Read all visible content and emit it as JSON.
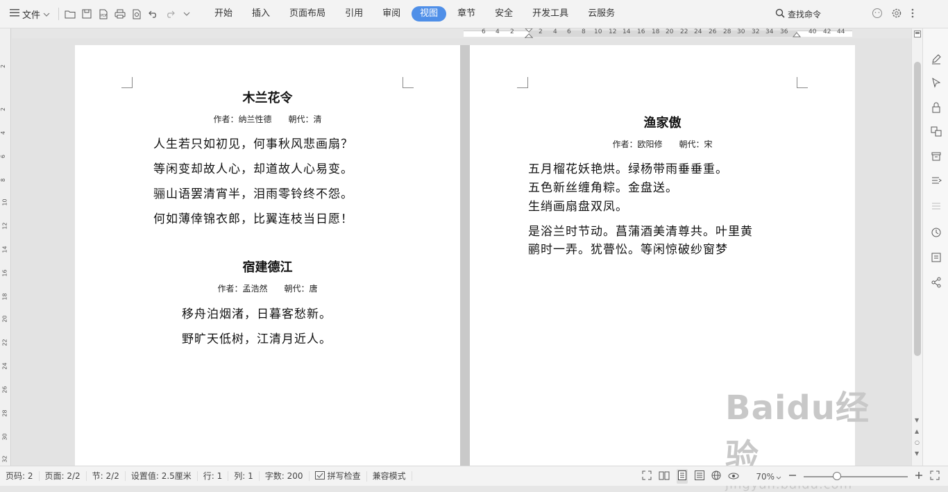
{
  "toolbar": {
    "menu_label": "文件",
    "tabs": [
      {
        "label": "开始"
      },
      {
        "label": "插入"
      },
      {
        "label": "页面布局"
      },
      {
        "label": "引用"
      },
      {
        "label": "审阅"
      },
      {
        "label": "视图",
        "active": true
      },
      {
        "label": "章节"
      },
      {
        "label": "安全"
      },
      {
        "label": "开发工具"
      },
      {
        "label": "云服务"
      }
    ],
    "search_label": "查找命令"
  },
  "ruler": {
    "labels": [
      "6",
      "4",
      "2",
      "2",
      "4",
      "6",
      "8",
      "10",
      "12",
      "14",
      "16",
      "18",
      "20",
      "22",
      "24",
      "26",
      "28",
      "30",
      "32",
      "34",
      "36",
      "40",
      "42",
      "44"
    ],
    "vertical_labels": [
      "2",
      "2",
      "4",
      "6",
      "8",
      "10",
      "12",
      "14",
      "16",
      "18",
      "20",
      "22",
      "24",
      "26",
      "28",
      "30",
      "32"
    ]
  },
  "page1": {
    "poem1": {
      "title": "木兰花令",
      "meta": "作者：纳兰性德　　朝代：清",
      "lines": [
        "人生若只如初见，何事秋风悲画扇？",
        "等闲变却故人心，却道故人心易变。",
        "骊山语罢清宵半，泪雨零铃终不怨。",
        "何如薄倖锦衣郎，比翼连枝当日愿！"
      ]
    },
    "poem2": {
      "title": "宿建德江",
      "meta": "作者：孟浩然　　朝代：唐",
      "lines": [
        "移舟泊烟渚，日暮客愁新。",
        "野旷天低树，江清月近人。"
      ]
    }
  },
  "page2": {
    "poem": {
      "title": "渔家傲",
      "meta": "作者：欧阳修　　朝代：宋",
      "lines": [
        "五月榴花妖艳烘。绿杨带雨垂垂重。",
        "五色新丝缠角粽。金盘送。",
        "生绡画扇盘双凤。",
        "是浴兰时节动。菖蒲酒美清尊共。叶里黄",
        "鹂时一弄。犹瞢忪。等闲惊破纱窗梦"
      ]
    }
  },
  "status": {
    "page_code": "页码: 2",
    "pages": "页面: 2/2",
    "section": "节: 2/2",
    "setting": "设置值: 2.5厘米",
    "row": "行: 1",
    "col": "列: 1",
    "word_count": "字数: 200",
    "spell_check": "拼写检查",
    "compat_mode": "兼容模式",
    "zoom": "70%"
  },
  "watermark": {
    "brand": "Baidu经验",
    "url": "jingyan.baidu.com"
  },
  "colors": {
    "accent": "#4f8fe8",
    "toolbar_bg": "#f3f3f3",
    "page_bg": "#ffffff",
    "canvas_bg": "#e3e3e3"
  }
}
